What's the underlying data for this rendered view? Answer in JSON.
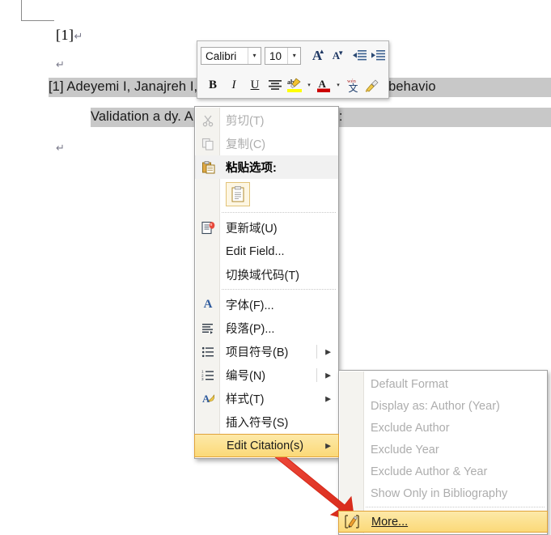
{
  "document": {
    "reference_number": "[1]",
    "pilcrow": "↵",
    "selected_text_line1": "[1] Adeyemi I, Janajreh I, Arink T, Ghenai C. Gasification behavio",
    "selected_text_line2": "Validation a                              dy. Applied Energy. 2017;185:"
  },
  "mini_toolbar": {
    "font_name": "Calibri",
    "font_size": "10",
    "dropdown_arrow": "▾",
    "grow_font": "A",
    "shrink_font": "A",
    "decrease_indent_icon": "decrease-indent-icon",
    "increase_indent_icon": "increase-indent-icon",
    "bold": "B",
    "italic": "I",
    "underline": "U",
    "align_center_icon": "align-center-icon",
    "highlight_label": "ab",
    "font_color": "A",
    "phonetic_guide": "wén",
    "format_painter_icon": "format-painter-icon",
    "split_arrow": "▾"
  },
  "context_menu": {
    "items": [
      {
        "label": "剪切(T)",
        "icon": "cut-icon",
        "disabled": true,
        "submenu": false
      },
      {
        "label": "复制(C)",
        "icon": "copy-icon",
        "disabled": true,
        "submenu": false
      },
      {
        "label": "粘贴选项:",
        "icon": "paste-icon",
        "disabled": false,
        "submenu": false,
        "bold": true
      },
      {
        "label": "更新域(U)",
        "icon": "update-field-icon",
        "disabled": false,
        "submenu": false
      },
      {
        "label": "Edit Field...",
        "icon": "",
        "disabled": false,
        "submenu": false
      },
      {
        "label": "切换域代码(T)",
        "icon": "",
        "disabled": false,
        "submenu": false
      },
      {
        "label": "字体(F)...",
        "icon": "font-icon",
        "disabled": false,
        "submenu": false
      },
      {
        "label": "段落(P)...",
        "icon": "paragraph-icon",
        "disabled": false,
        "submenu": false
      },
      {
        "label": "项目符号(B)",
        "icon": "bullets-icon",
        "disabled": false,
        "submenu": true
      },
      {
        "label": "编号(N)",
        "icon": "numbering-icon",
        "disabled": false,
        "submenu": true
      },
      {
        "label": "样式(T)",
        "icon": "styles-icon",
        "disabled": false,
        "submenu": true
      },
      {
        "label": "插入符号(S)",
        "icon": "",
        "disabled": false,
        "submenu": false
      },
      {
        "label": "Edit Citation(s)",
        "icon": "",
        "disabled": false,
        "submenu": true,
        "highlighted": true
      }
    ]
  },
  "submenu": {
    "items": [
      {
        "label": "Default Format",
        "disabled": true
      },
      {
        "label": "Display as: Author (Year)",
        "disabled": true
      },
      {
        "label": "Exclude Author",
        "disabled": true
      },
      {
        "label": "Exclude Year",
        "disabled": true
      },
      {
        "label": "Exclude Author & Year",
        "disabled": true
      },
      {
        "label": "Show Only in Bibliography",
        "disabled": true
      },
      {
        "label": "More...",
        "disabled": false,
        "highlighted": true,
        "icon": "edit-pencil-icon"
      }
    ]
  },
  "annotation": {
    "arrow_color": "#e8382c",
    "arrow_name": "red-pointer-arrow"
  },
  "colors": {
    "highlight_gradient_top": "#fde9a9",
    "highlight_gradient_bottom": "#fbd978",
    "highlight_border": "#e0a33a",
    "selection_gray": "#c8c8c8",
    "menu_gutter": "#f4f3ef",
    "disabled_text": "#adadad"
  }
}
